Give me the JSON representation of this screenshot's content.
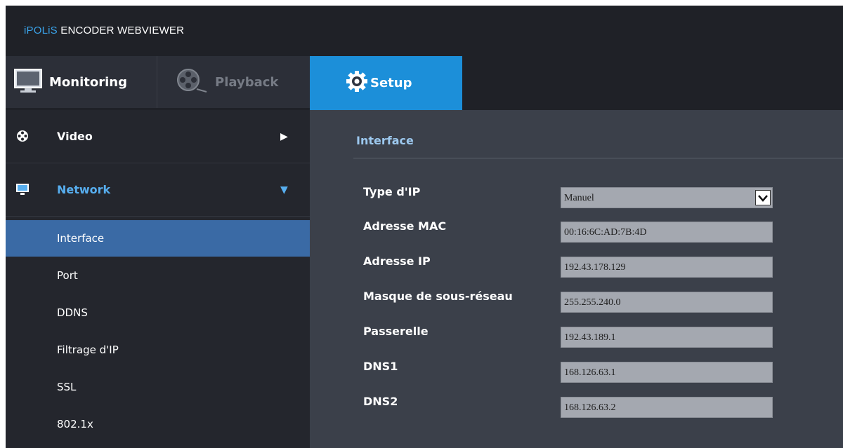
{
  "app": {
    "brand_accent": "iPOLiS",
    "brand_rest": " ENCODER WEBVIEWER",
    "accent_color": "#1c8fd9"
  },
  "tabs": [
    {
      "label": "Monitoring",
      "icon": "monitor-icon",
      "active": false
    },
    {
      "label": "Playback",
      "icon": "film-reel-icon",
      "active": false
    },
    {
      "label": "Setup",
      "icon": "gear-icon",
      "active": true
    }
  ],
  "sidebar": {
    "sections": [
      {
        "label": "Video",
        "icon": "film-reel-icon",
        "expanded": false
      },
      {
        "label": "Network",
        "icon": "monitor-icon",
        "expanded": true
      }
    ],
    "items": [
      "Interface",
      "Port",
      "DDNS",
      "Filtrage d'IP",
      "SSL",
      "802.1x"
    ],
    "active_item": "Interface"
  },
  "content": {
    "title": "Interface",
    "fields": [
      {
        "label": "Type d'IP",
        "value": "Manuel",
        "kind": "select"
      },
      {
        "label": "Adresse MAC",
        "value": "00:16:6C:AD:7B:4D",
        "kind": "text"
      },
      {
        "label": "Adresse IP",
        "value": "192.43.178.129",
        "kind": "text"
      },
      {
        "label": "Masque de sous-réseau",
        "value": "255.255.240.0",
        "kind": "text"
      },
      {
        "label": "Passerelle",
        "value": "192.43.189.1",
        "kind": "text"
      },
      {
        "label": "DNS1",
        "value": "168.126.63.1",
        "kind": "text"
      },
      {
        "label": "DNS2",
        "value": "168.126.63.2",
        "kind": "text"
      }
    ]
  }
}
